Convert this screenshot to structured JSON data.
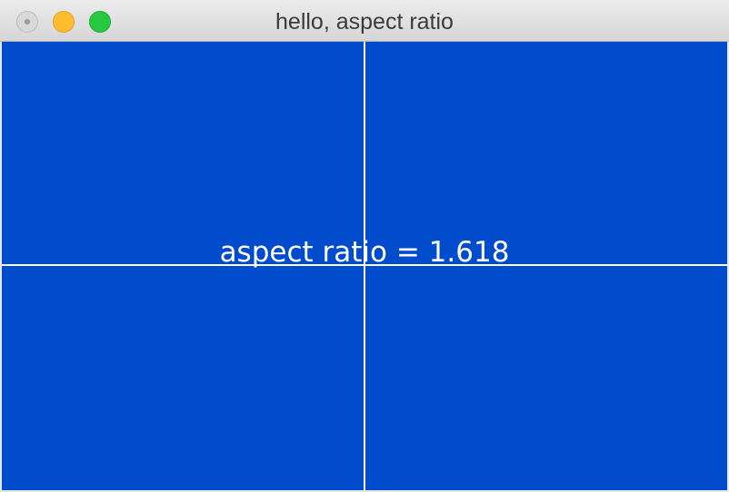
{
  "window": {
    "title": "hello, aspect ratio",
    "controls": [
      "close",
      "minimize",
      "zoom"
    ]
  },
  "canvas": {
    "background_color": "#004ccc",
    "line_color": "#ffffff",
    "label": "aspect ratio = 1.618"
  }
}
